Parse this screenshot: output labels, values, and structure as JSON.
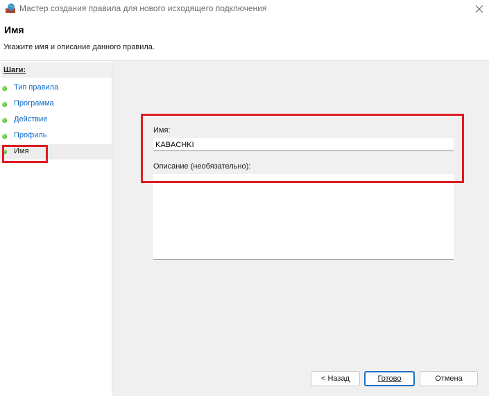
{
  "window": {
    "title": "Мастер создания правила для нового исходящего подключения",
    "app_icon": "firewall-globe-icon",
    "close_icon": "close-icon"
  },
  "header": {
    "title": "Имя",
    "subtitle": "Укажите имя и описание данного правила."
  },
  "sidebar": {
    "steps_label": "Шаги:",
    "steps": [
      {
        "label": "Тип правила",
        "current": false
      },
      {
        "label": "Программа",
        "current": false
      },
      {
        "label": "Действие",
        "current": false
      },
      {
        "label": "Профиль",
        "current": false
      },
      {
        "label": "Имя",
        "current": true
      }
    ]
  },
  "form": {
    "name_label": "Имя:",
    "name_value": "KABACHKI",
    "description_label": "Описание (необязательно):",
    "description_value": ""
  },
  "buttons": {
    "back": "< Назад",
    "done": "Готово",
    "cancel": "Отмена"
  },
  "colors": {
    "highlight": "#e01b24",
    "link": "#0a66c8",
    "default_button_border": "#1a6fc4"
  }
}
